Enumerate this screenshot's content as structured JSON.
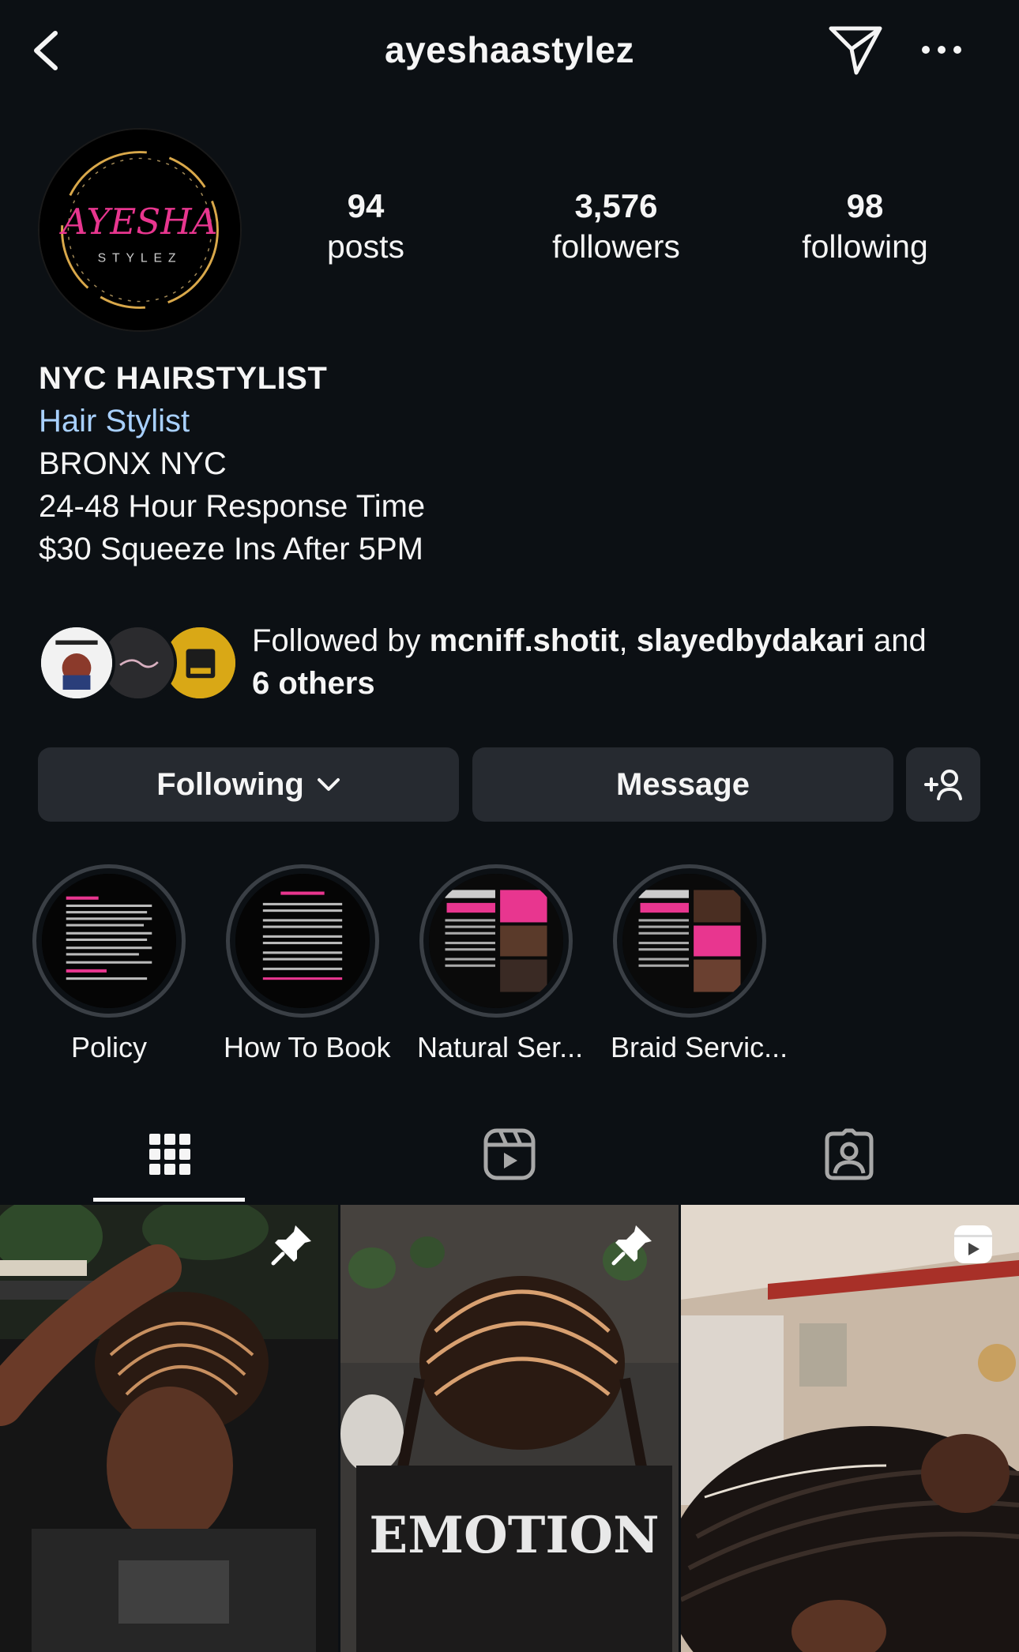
{
  "header": {
    "username": "ayeshaastylez"
  },
  "avatar": {
    "logo_text": "AYESHA",
    "logo_sub": "STYLEZ"
  },
  "stats": {
    "posts": {
      "num": "94",
      "label": "posts"
    },
    "followers": {
      "num": "3,576",
      "label": "followers"
    },
    "following": {
      "num": "98",
      "label": "following"
    }
  },
  "bio": {
    "name": "NYC HAIRSTYLIST",
    "category": "Hair Stylist",
    "lines": [
      "BRONX NYC",
      "24-48 Hour Response Time",
      "$30 Squeeze Ins After 5PM"
    ]
  },
  "followed_by": {
    "prefix": "Followed by ",
    "user1": "mcniff.shotit",
    "sep": ", ",
    "user2": "slayedbydakari",
    "and": " and",
    "others": "6 others"
  },
  "actions": {
    "following": "Following",
    "message": "Message"
  },
  "highlights": [
    {
      "label": "Policy"
    },
    {
      "label": "How To Book"
    },
    {
      "label": "Natural Ser..."
    },
    {
      "label": "Braid Servic..."
    }
  ],
  "posts": [
    {
      "badge": "pin-icon"
    },
    {
      "badge": "pin-icon",
      "shirt_text": "EMOTION"
    },
    {
      "badge": "reel-icon"
    }
  ],
  "colors": {
    "background": "#0c1014",
    "button": "#262a30",
    "link": "#a8d0ff",
    "text": "#f5f5f5",
    "accent_pink": "#e8368f"
  }
}
